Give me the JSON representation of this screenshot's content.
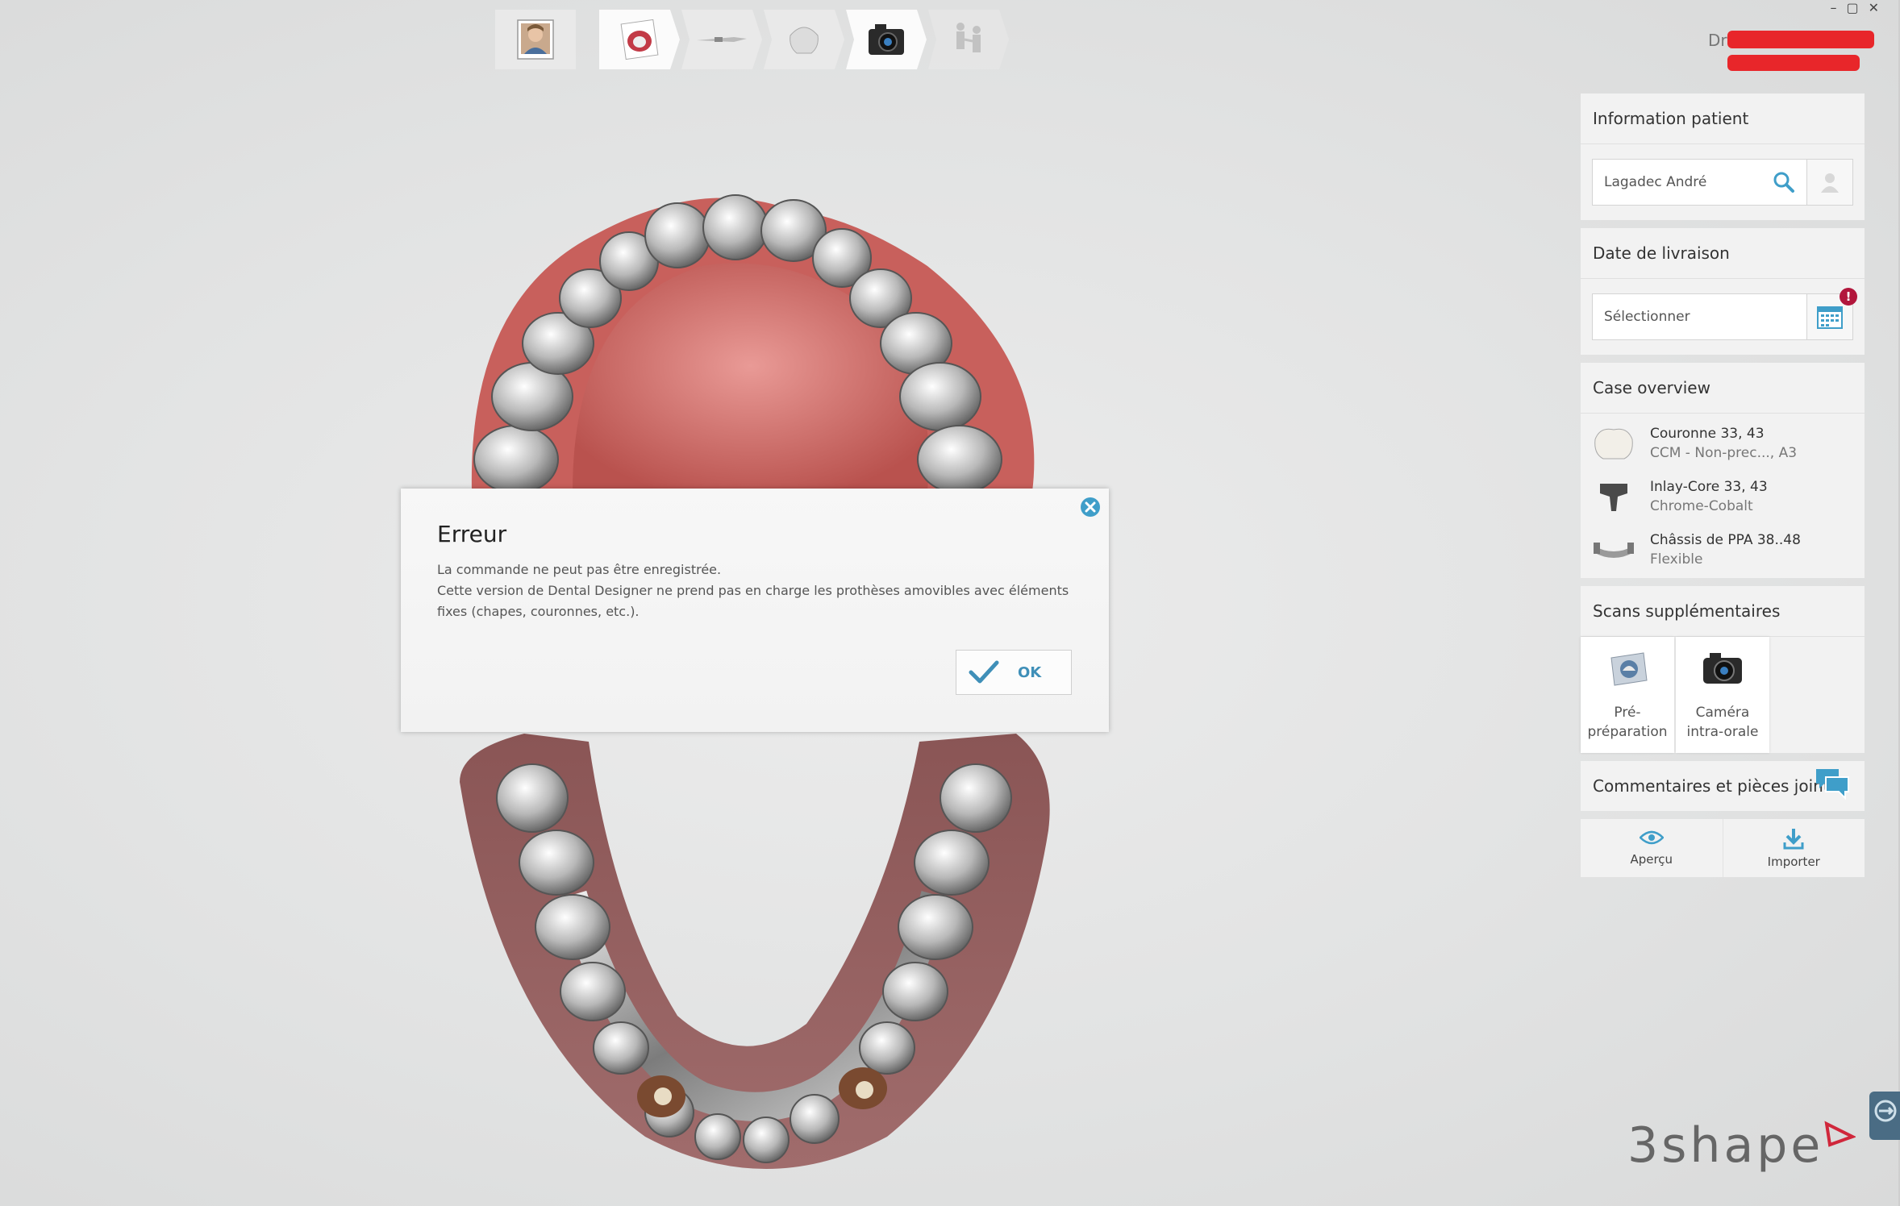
{
  "window": {
    "controls": [
      "–",
      "▢",
      "✕"
    ]
  },
  "workflow": {
    "steps": [
      {
        "name": "patient",
        "icon": "patient-photo-icon"
      },
      {
        "name": "model",
        "icon": "dental-model-icon"
      },
      {
        "name": "impression",
        "icon": "implant-icon"
      },
      {
        "name": "design",
        "icon": "dental-cap-icon"
      },
      {
        "name": "scan",
        "icon": "camera-icon"
      },
      {
        "name": "send",
        "icon": "people-icon"
      }
    ]
  },
  "user": {
    "prefix": "Dr"
  },
  "panel": {
    "patient": {
      "header": "Information patient",
      "name": "Lagadec André"
    },
    "delivery": {
      "header": "Date de livraison",
      "placeholder": "Sélectionner",
      "badge": "!"
    },
    "case": {
      "header": "Case overview",
      "items": [
        {
          "title": "Couronne 33, 43",
          "sub": "CCM - Non-prec..., A3",
          "icon": "crown-icon"
        },
        {
          "title": "Inlay-Core 33, 43",
          "sub": "Chrome-Cobalt",
          "icon": "inlay-core-icon"
        },
        {
          "title": "Châssis de PPA 38..48",
          "sub": "Flexible",
          "icon": "partial-frame-icon"
        }
      ]
    },
    "scans": {
      "header": "Scans supplémentaires",
      "tiles": [
        {
          "line1": "Pré-",
          "line2": "préparation",
          "icon": "pre-preparation-icon"
        },
        {
          "line1": "Caméra",
          "line2": "intra-orale",
          "icon": "intraoral-camera-icon"
        }
      ]
    },
    "comments": {
      "header": "Commentaires et pièces jointes"
    },
    "actions": {
      "preview": "Aperçu",
      "import": "Importer"
    }
  },
  "dialog": {
    "title": "Erreur",
    "line1": "La commande ne peut pas être enregistrée.",
    "line2": "Cette version de Dental Designer ne prend pas en charge les prothèses amovibles avec éléments fixes (chapes, couronnes, etc.).",
    "ok": "OK"
  },
  "logo": {
    "text": "3shape"
  },
  "colors": {
    "accent": "#3f9ec9",
    "gum": "#d98a8a",
    "error_badge": "#b2163c",
    "redaction": "#e8262a"
  }
}
